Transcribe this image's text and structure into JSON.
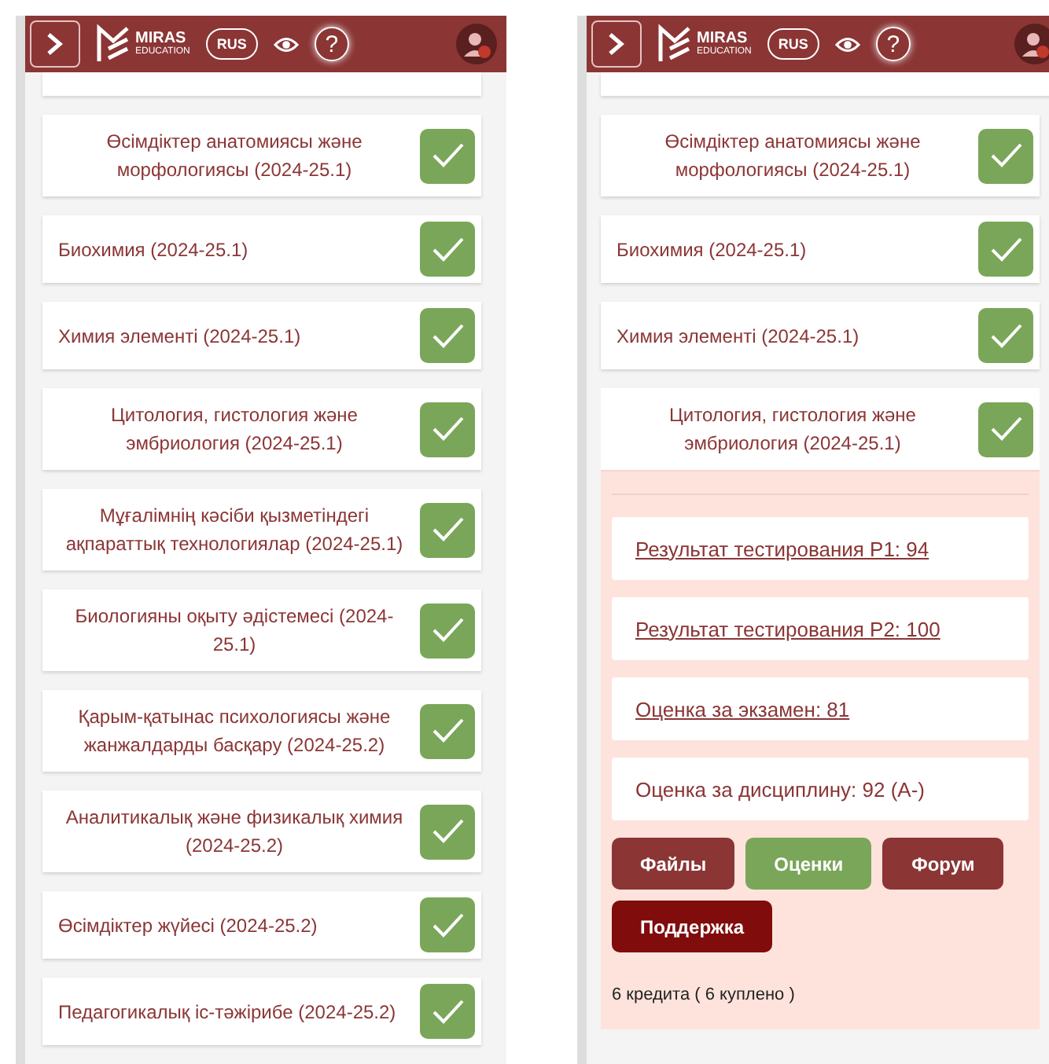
{
  "screens": [
    {
      "header": {
        "logo_title": "MIRAS",
        "logo_subtitle": "EDUCATION",
        "language": "RUS",
        "help": "?"
      },
      "courses": [
        {
          "title": "Өсімдіктер анатомиясы және морфологиясы (2024-25.1)",
          "checked": true,
          "expanded": false
        },
        {
          "title": "Биохимия (2024-25.1)",
          "checked": true,
          "expanded": false
        },
        {
          "title": "Химия элементі (2024-25.1)",
          "checked": true,
          "expanded": false
        },
        {
          "title": "Цитология, гистология және эмбриология (2024-25.1)",
          "checked": true,
          "expanded": false
        },
        {
          "title": "Мұғалімнің кәсіби қызметіндегі ақпараттық технологиялар (2024-25.1)",
          "checked": true,
          "expanded": false
        },
        {
          "title": "Биологияны оқыту әдістемесі (2024-25.1)",
          "checked": true,
          "expanded": false
        },
        {
          "title": "Қарым-қатынас психологиясы және жанжалдарды басқару (2024-25.2)",
          "checked": true,
          "expanded": false
        },
        {
          "title": "Аналитикалық және физикалық химия (2024-25.2)",
          "checked": true,
          "expanded": false
        },
        {
          "title": "Өсімдіктер жүйесі (2024-25.2)",
          "checked": true,
          "expanded": false
        },
        {
          "title": "Педагогикалық іс-тәжірибе (2024-25.2)",
          "checked": true,
          "expanded": false
        }
      ]
    },
    {
      "header": {
        "logo_title": "MIRAS",
        "logo_subtitle": "EDUCATION",
        "language": "RUS",
        "help": "?"
      },
      "courses": [
        {
          "title": "Өсімдіктер анатомиясы және морфологиясы (2024-25.1)",
          "checked": true,
          "expanded": false
        },
        {
          "title": "Биохимия (2024-25.1)",
          "checked": true,
          "expanded": false
        },
        {
          "title": "Химия элементі (2024-25.1)",
          "checked": true,
          "expanded": false
        },
        {
          "title": "Цитология, гистология және эмбриология (2024-25.1)",
          "checked": true,
          "expanded": true,
          "details": {
            "results": [
              {
                "text": "Результат тестирования Р1: 94",
                "kind": "link"
              },
              {
                "text": "Результат тестирования Р2: 100",
                "kind": "link"
              },
              {
                "text": "Оценка за экзамен: 81",
                "kind": "link"
              },
              {
                "text": "Оценка за дисциплину: 92 (А-)",
                "kind": "text"
              }
            ],
            "buttons": [
              {
                "label": "Файлы",
                "color": "#8b3535"
              },
              {
                "label": "Оценки",
                "color": "#7aa65a"
              },
              {
                "label": "Форум",
                "color": "#8b3535"
              },
              {
                "label": "Поддержка",
                "color": "#800c0c"
              }
            ],
            "credits": "6 кредита ( 6 куплено )"
          }
        }
      ]
    }
  ]
}
